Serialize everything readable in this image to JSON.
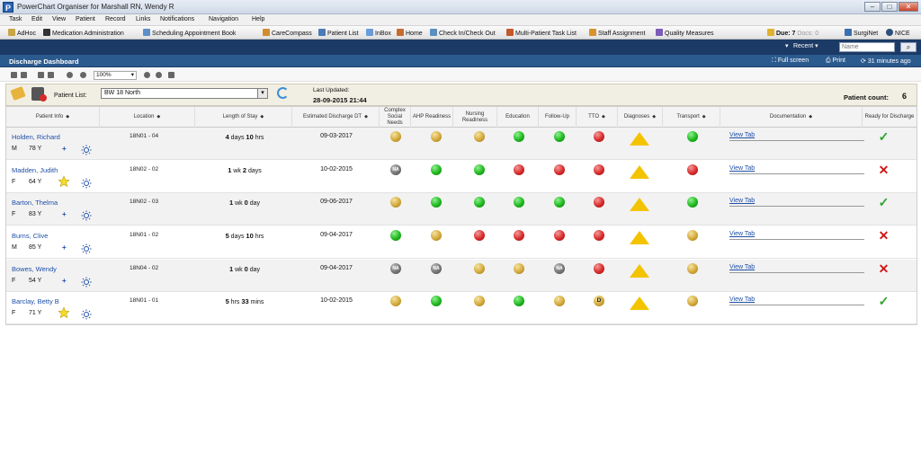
{
  "window": {
    "app_letter": "P",
    "title": "PowerChart Organiser for Marshall RN, Wendy R"
  },
  "menu": [
    "Task",
    "Edit",
    "View",
    "Patient",
    "Record",
    "Links",
    "Notifications",
    "Navigation",
    "Help"
  ],
  "toolbar": {
    "items": [
      "AdHoc",
      "Medication Administration",
      "Scheduling Appointment Book",
      "CareCompass",
      "Patient List",
      "InBox",
      "Home",
      "Check In/Check Out",
      "Multi-Patient Task List",
      "Staff Assignment",
      "Quality Measures"
    ],
    "due": "Due: 7",
    "docs": "Docs: 0",
    "right_items": [
      "SurgiNet",
      "NICE"
    ]
  },
  "search": {
    "recent": "Recent",
    "name_placeholder": "Name"
  },
  "dashboard": {
    "title": "Discharge Dashboard",
    "full_screen": "Full screen",
    "print": "Print",
    "minutes_ago": "31 minutes ago",
    "zoom": "100%"
  },
  "patient_list": {
    "label": "Patient List:",
    "value": "BW 18 North",
    "last_updated_label": "Last Updated:",
    "last_updated_value": "28-09-2015 21:44",
    "count_label": "Patient count:",
    "count_value": "6"
  },
  "columns": [
    "Patient Info",
    "Location",
    "Length of Stay",
    "Estimated Discharge DT",
    "Complex Social Needs",
    "AHP Readiness",
    "Nursing Readiness",
    "Education",
    "Follow-Up",
    "TTO",
    "Diagnoses",
    "Transport",
    "Documentation",
    "Ready for Discharge"
  ],
  "colors": {
    "green": "#1fb81f",
    "amber": "#d4a93c",
    "red": "#d82a2a",
    "na": "#777777",
    "link": "#1f4fa6",
    "header": "#2b5a8e"
  },
  "patients": [
    {
      "name": "Holden, Richard",
      "sex": "M",
      "age": "78 Y",
      "star": false,
      "location": "18N01 - 04",
      "los_a": "4",
      "los_a_unit": " days ",
      "los_b": "10",
      "los_b_unit": " hrs",
      "edd": "09-03-2017",
      "status": [
        "amber",
        "amber",
        "amber",
        "green",
        "green",
        "red"
      ],
      "transport": "green",
      "doc_link": "View Tab",
      "ready": "yes"
    },
    {
      "name": "Madden, Judith",
      "sex": "F",
      "age": "64 Y",
      "star": true,
      "location": "18N02 - 02",
      "los_a": "1",
      "los_a_unit": " wk ",
      "los_b": "2",
      "los_b_unit": " days",
      "edd": "10-02-2015",
      "status": [
        "na",
        "green",
        "green",
        "red",
        "red",
        "red"
      ],
      "transport": "red",
      "doc_link": "View Tab",
      "ready": "no"
    },
    {
      "name": "Barton, Thelma",
      "sex": "F",
      "age": "83 Y",
      "star": false,
      "location": "18N02 - 03",
      "los_a": "1",
      "los_a_unit": " wk ",
      "los_b": "0",
      "los_b_unit": " day",
      "edd": "09-06-2017",
      "status": [
        "amber",
        "green",
        "green",
        "green",
        "green",
        "red"
      ],
      "transport": "green",
      "doc_link": "View Tab",
      "ready": "yes"
    },
    {
      "name": "Burns, Clive",
      "sex": "M",
      "age": "85 Y",
      "star": false,
      "location": "18N01 - 02",
      "los_a": "5",
      "los_a_unit": " days ",
      "los_b": "10",
      "los_b_unit": " hrs",
      "edd": "09-04-2017",
      "status": [
        "green",
        "amber",
        "red",
        "red",
        "red",
        "red"
      ],
      "transport": "amber",
      "doc_link": "View Tab",
      "ready": "no"
    },
    {
      "name": "Bowes, Wendy",
      "sex": "F",
      "age": "54 Y",
      "star": false,
      "location": "18N04 - 02",
      "los_a": "1",
      "los_a_unit": " wk ",
      "los_b": "0",
      "los_b_unit": " day",
      "edd": "09-04-2017",
      "status": [
        "na",
        "na",
        "amber",
        "amber",
        "na",
        "red"
      ],
      "transport": "amber",
      "doc_link": "View Tab",
      "ready": "no"
    },
    {
      "name": "Barclay, Betty B",
      "sex": "F",
      "age": "71 Y",
      "star": true,
      "location": "18N01 - 01",
      "los_a": "5",
      "los_a_unit": " hrs ",
      "los_b": "33",
      "los_b_unit": " mins",
      "edd": "10-02-2015",
      "status": [
        "amber",
        "green",
        "amber",
        "green",
        "amber",
        "d"
      ],
      "transport": "amber",
      "doc_link": "View Tab",
      "ready": "yes"
    }
  ],
  "markers": {
    "na": "NA",
    "d": "D",
    "yes": "✓",
    "no": "✕",
    "plus": "+"
  }
}
